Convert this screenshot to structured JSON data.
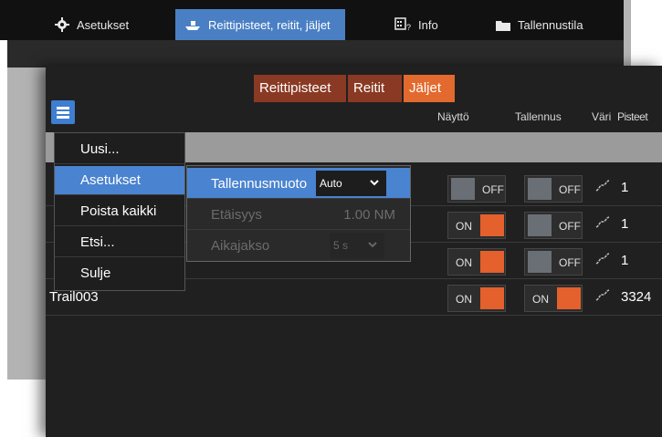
{
  "top_tabs": [
    {
      "label": "Asetukset",
      "icon": "gear-icon"
    },
    {
      "label": "Reittipisteet, reitit, jäljet",
      "icon": "boat-icon"
    },
    {
      "label": "Info",
      "icon": "info-icon"
    },
    {
      "label": "Tallennustila",
      "icon": "folder-icon"
    }
  ],
  "sub_tabs": [
    "Reittipisteet",
    "Reitit",
    "Jäljet"
  ],
  "columns": {
    "naytto": "Näyttö",
    "tallennus": "Tallennus",
    "vari": "Väri",
    "pisteet": "Pisteet"
  },
  "menu": {
    "items": [
      "Uusi...",
      "Asetukset",
      "Poista kaikki",
      "Etsi...",
      "Sulje"
    ],
    "selected": "Asetukset"
  },
  "submenu": {
    "tallennusmuoto": {
      "label": "Tallennusmuoto",
      "value": "Auto"
    },
    "etaisyys": {
      "label": "Etäisyys",
      "value": "1.00 NM"
    },
    "aikajakso": {
      "label": "Aikajakso",
      "value": "5 s"
    }
  },
  "rows": [
    {
      "name": "",
      "naytto": "OFF",
      "tallennus": "OFF",
      "pisteet": "1"
    },
    {
      "name": "",
      "naytto": "ON",
      "tallennus": "OFF",
      "pisteet": "1"
    },
    {
      "name": "",
      "naytto": "ON",
      "tallennus": "OFF",
      "pisteet": "1"
    },
    {
      "name": "Trail003",
      "naytto": "ON",
      "tallennus": "ON",
      "pisteet": "3324"
    }
  ],
  "colors": {
    "accent": "#4a83d0",
    "on": "#e4602c",
    "off": "#6a6f76",
    "active_tab": "#e36a2f"
  }
}
